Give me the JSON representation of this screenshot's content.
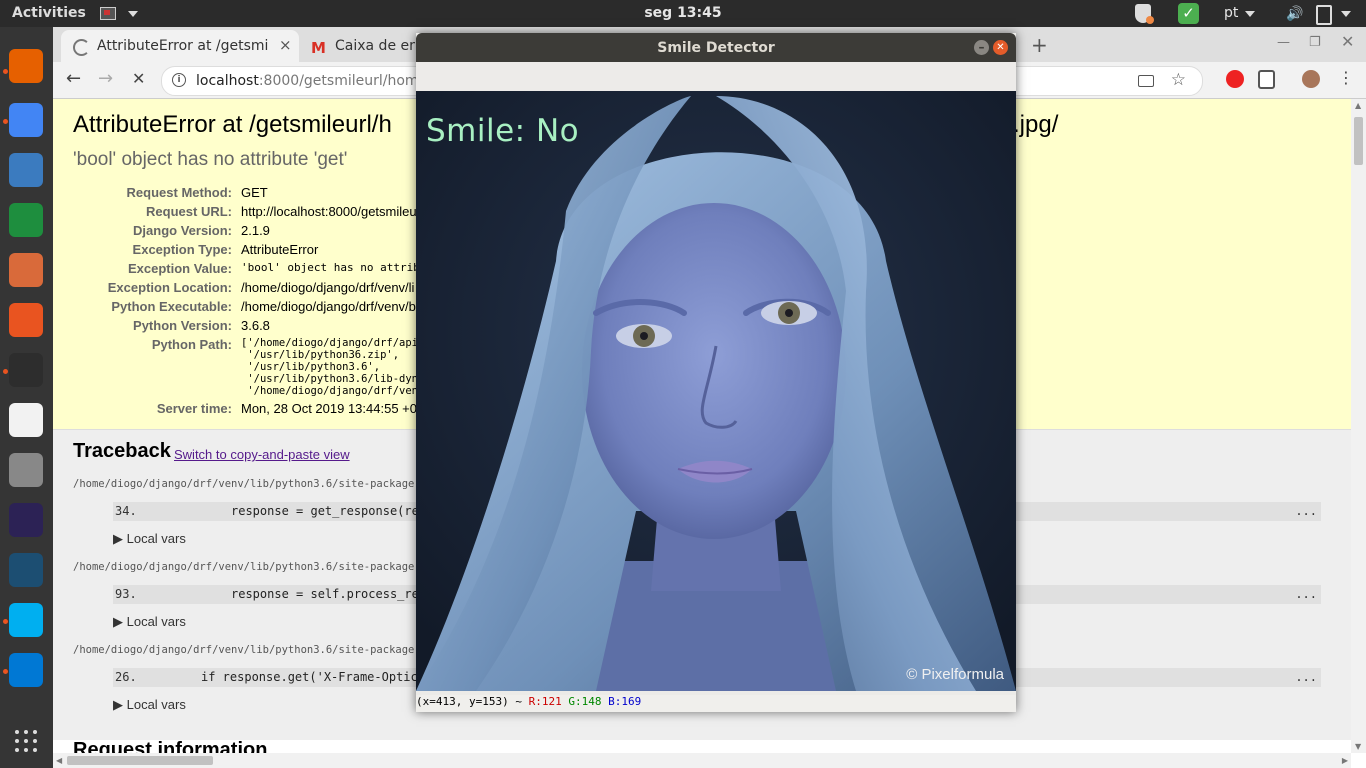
{
  "topbar": {
    "activities": "Activities",
    "clock": "seg 13:45",
    "language": "pt",
    "volume_glyph": "🔊"
  },
  "dock": {
    "apps": [
      {
        "name": "firefox-icon",
        "color": "#e66000"
      },
      {
        "name": "chrome-icon",
        "color": "#4285f4"
      },
      {
        "name": "libreoffice-impress-icon",
        "color": "#3b7bbf"
      },
      {
        "name": "libreoffice-calc-icon",
        "color": "#1e8e3e"
      },
      {
        "name": "document-viewer-icon",
        "color": "#d96a3a"
      },
      {
        "name": "software-center-icon",
        "color": "#e95420"
      },
      {
        "name": "terminal-icon",
        "color": "#2d2d2d"
      },
      {
        "name": "text-editor-icon",
        "color": "#f2f2f2"
      },
      {
        "name": "settings-icon",
        "color": "#888888"
      },
      {
        "name": "eclipse-icon",
        "color": "#2c2255"
      },
      {
        "name": "mysql-workbench-icon",
        "color": "#1c4e72"
      },
      {
        "name": "skype-icon",
        "color": "#00aff0"
      },
      {
        "name": "vscode-icon",
        "color": "#0078d4"
      }
    ]
  },
  "browser": {
    "tabs": [
      {
        "title": "AttributeError at /getsmi",
        "close": "×"
      },
      {
        "title": "Caixa de ent"
      }
    ],
    "new_tab": "+",
    "url_host": "localhost",
    "url_rest": ":8000/getsmileurl/home-d",
    "nav": {
      "back": "←",
      "forward": "→",
      "stop": "✕",
      "star": "☆"
    }
  },
  "error_page": {
    "title_left": "AttributeError at /getsmileurl/h",
    "title_right": ".jpg/",
    "subtitle": "'bool' object has no attribute 'get'",
    "meta": [
      {
        "label": "Request Method:",
        "value": "GET"
      },
      {
        "label": "Request URL:",
        "value": "http://localhost:8000/getsmileu"
      },
      {
        "label": "Django Version:",
        "value": "2.1.9"
      },
      {
        "label": "Exception Type:",
        "value": "AttributeError"
      },
      {
        "label": "Exception Value:",
        "value": "'bool' object has no attribu"
      },
      {
        "label": "Exception Location:",
        "value": "/home/diogo/django/drf/venv/li"
      },
      {
        "label": "Python Executable:",
        "value": "/home/diogo/django/drf/venv/b"
      },
      {
        "label": "Python Version:",
        "value": "3.6.8"
      },
      {
        "label": "Python Path:",
        "value": ""
      },
      {
        "label": "Server time:",
        "value": "Mon, 28 Oct 2019 13:44:55 +0"
      }
    ],
    "python_path": "['/home/diogo/django/drf/api\n '/usr/lib/python36.zip',\n '/usr/lib/python3.6',\n '/usr/lib/python3.6/lib-dyn\n '/home/diogo/django/drf/ven",
    "traceback_heading": "Traceback",
    "switch_link": "Switch to copy-and-paste view",
    "frames": [
      {
        "path": "/home/diogo/django/drf/venv/lib/python3.6/site-package",
        "num": "34.",
        "code": "response = get_response(re",
        "indent": 118,
        "dots": "...",
        "local": "▶ Local vars"
      },
      {
        "path": "/home/diogo/django/drf/venv/lib/python3.6/site-package",
        "num": "93.",
        "code": "response = self.process_re",
        "indent": 118,
        "dots": "...",
        "local": "▶ Local vars"
      },
      {
        "path": "/home/diogo/django/drf/venv/lib/python3.6/site-package",
        "num": "26.",
        "code": "if response.get('X-Frame-Optic",
        "indent": 88,
        "dots": "...",
        "local": "▶ Local vars"
      }
    ],
    "request_info": "Request information"
  },
  "smile_window": {
    "title": "Smile Detector",
    "overlay_label": "Smile:  No",
    "credit": "© Pixelformula",
    "status": {
      "coords": "(x=413, y=153) ~",
      "r": "R:121",
      "g": "G:148",
      "b": "B:169"
    }
  },
  "colors": {
    "error_bg": "#ffffcc",
    "overlay_text": "#a8f0c2",
    "ubuntu_orange": "#e95420"
  }
}
